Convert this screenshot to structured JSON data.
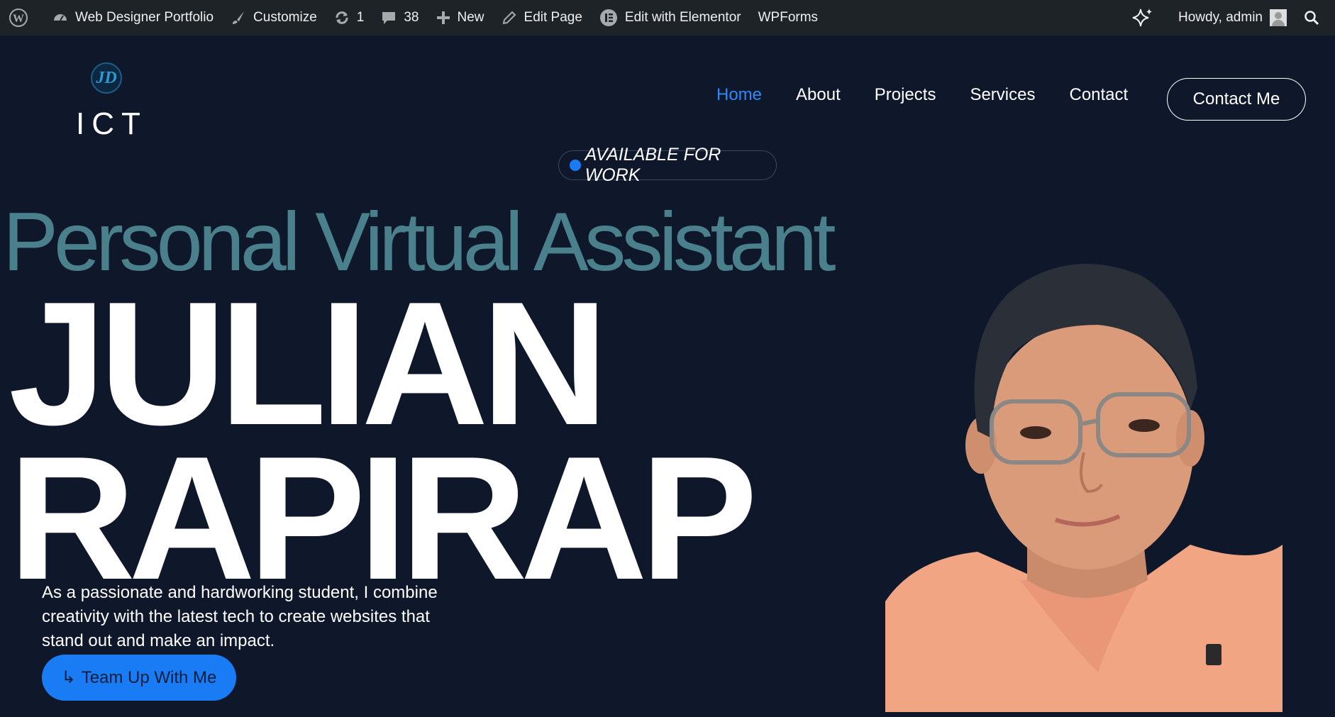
{
  "adminbar": {
    "site_name": "Web Designer Portfolio",
    "customize": "Customize",
    "updates_count": "1",
    "comments_count": "38",
    "new_label": "New",
    "edit_page": "Edit Page",
    "elementor": "Edit with Elementor",
    "wpforms": "WPForms",
    "howdy": "Howdy, admin"
  },
  "logo": {
    "mark": "JD",
    "text": "ICT"
  },
  "nav": {
    "items": [
      "Home",
      "About",
      "Projects",
      "Services",
      "Contact"
    ],
    "active": "Home",
    "cta": "Contact Me"
  },
  "hero": {
    "badge": "AVAILABLE FOR WORK",
    "subtitle": "Personal Virtual Assistant",
    "first_name": "JULIAN",
    "last_name": "RAPIRAP",
    "description": "As a passionate and hardworking student, I combine creativity with the latest tech to create websites that stand out and make an impact.",
    "cta_arrow": "↳",
    "cta_label": "Team Up With Me"
  },
  "colors": {
    "background": "#0f172a",
    "accent": "#1a7cf5",
    "subtitle": "#4a7f8c",
    "adminbar": "#1d2327"
  }
}
